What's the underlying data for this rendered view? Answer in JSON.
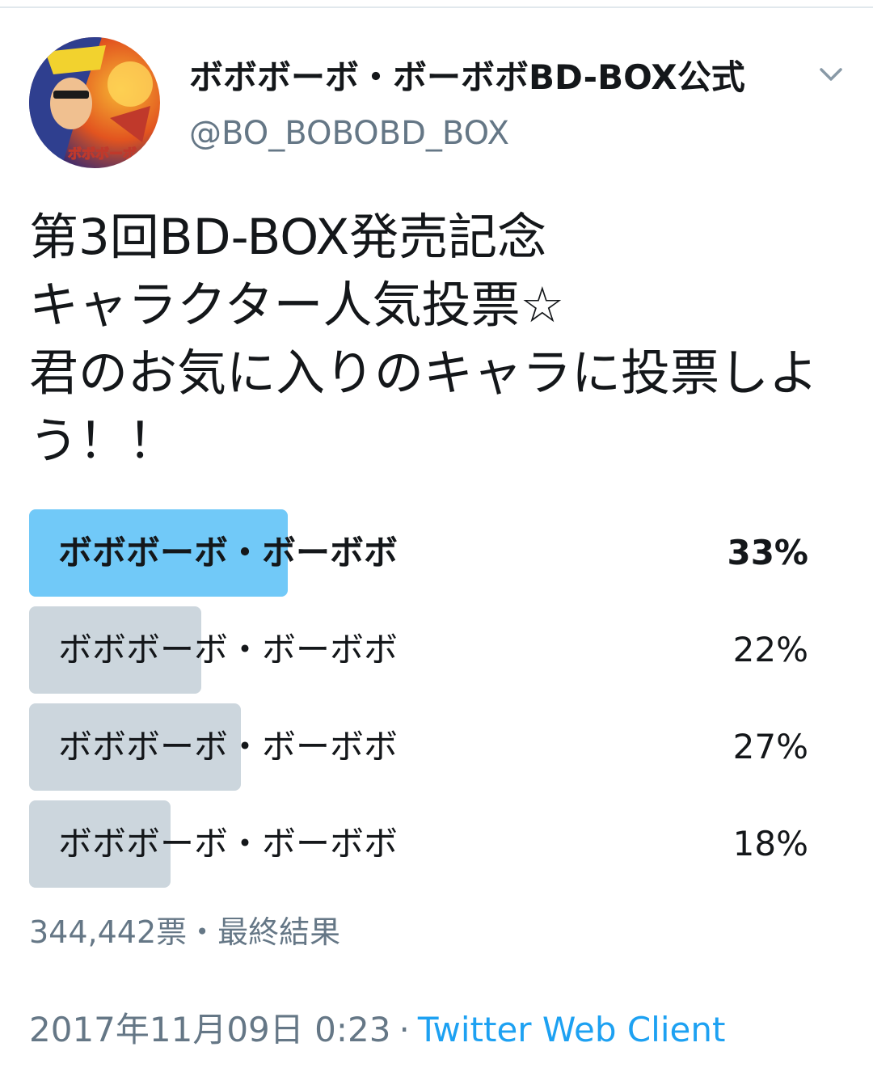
{
  "account": {
    "display_name": "ボボボーボ・ボーボボBD-BOX公式",
    "handle": "@BO_BOBOBD_BOX",
    "avatar_text": "ボボボーボ・ボーボボ"
  },
  "tweet": {
    "text": "第3回BD-BOX発売記念\nキャラクター人気投票☆\n君のお気に入りのキャラに投票しよう！！"
  },
  "poll": {
    "options": [
      {
        "label": "ボボボーボ・ボーボボ",
        "percent_text": "33%",
        "percent": 33,
        "winner": true
      },
      {
        "label": "ボボボーボ・ボーボボ",
        "percent_text": "22%",
        "percent": 22,
        "winner": false
      },
      {
        "label": "ボボボーボ・ボーボボ",
        "percent_text": "27%",
        "percent": 27,
        "winner": false
      },
      {
        "label": "ボボボーボ・ボーボボ",
        "percent_text": "18%",
        "percent": 18,
        "winner": false
      }
    ],
    "meta": "344,442票・最終結果"
  },
  "footer": {
    "timestamp": "2017年11月09日 0:23",
    "separator": "·",
    "client": "Twitter Web Client"
  },
  "colors": {
    "winner_bar": "#71c9f8",
    "other_bar": "#ccd6dd",
    "link": "#1da1f2",
    "secondary_text": "#657786"
  },
  "icons": {
    "menu": "chevron-down-icon"
  }
}
